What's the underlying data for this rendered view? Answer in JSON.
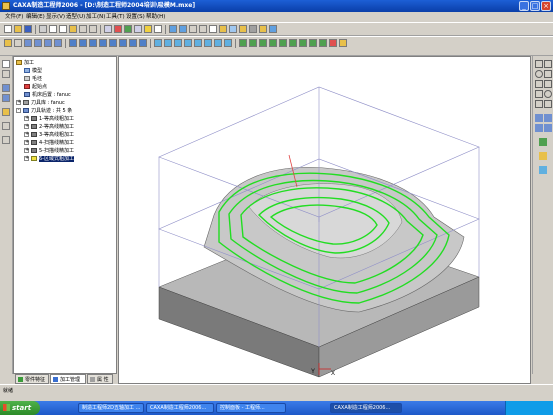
{
  "window": {
    "title": "CAXA制造工程师2006 - [D:\\制造工程师2004培训\\吸模M.mxe]"
  },
  "menu": [
    "文件(F)",
    "编辑(E)",
    "显示(V)",
    "造型(U)",
    "加工(N)",
    "工具(T)",
    "设置(S)",
    "帮助(H)"
  ],
  "tree": {
    "items": [
      {
        "label": "加工",
        "level": 0,
        "icon": "folder-icon",
        "expander": ""
      },
      {
        "label": "模型",
        "level": 1,
        "icon": "model-icon",
        "expander": ""
      },
      {
        "label": "毛坯",
        "level": 1,
        "icon": "stock-icon",
        "expander": ""
      },
      {
        "label": "起始点",
        "level": 1,
        "icon": "start-point-icon",
        "expander": ""
      },
      {
        "label": "机床后置 : fanuc",
        "level": 1,
        "icon": "machine-icon",
        "expander": ""
      },
      {
        "label": "刀具库 : fanuc",
        "level": 1,
        "icon": "tool-library-icon",
        "expander": "+"
      },
      {
        "label": "刀具轨迹 : 共 5 条",
        "level": 1,
        "icon": "toolpath-icon",
        "expander": "-"
      },
      {
        "label": "1-等高线粗加工",
        "level": 2,
        "icon": "path-folder-icon",
        "expander": "+"
      },
      {
        "label": "2-等高线精加工",
        "level": 2,
        "icon": "path-folder-icon",
        "expander": "+"
      },
      {
        "label": "3-等高线粗加工",
        "level": 2,
        "icon": "path-folder-icon",
        "expander": "+"
      },
      {
        "label": "4-扫描线精加工",
        "level": 2,
        "icon": "path-folder-icon",
        "expander": "+"
      },
      {
        "label": "5-扫描线精加工",
        "level": 2,
        "icon": "path-folder-icon",
        "expander": "+"
      },
      {
        "label": "6-区域式粗加工",
        "level": 2,
        "icon": "path-folder-icon",
        "expander": "+",
        "selected": true
      }
    ]
  },
  "panel_tabs": [
    "零件特征",
    "加工管理",
    "属 性"
  ],
  "status": {
    "text": "就绪"
  },
  "taskbar": {
    "start": "start",
    "buttons": [
      "制造工程师2D五轴加工 ...",
      "CAXA制造工程师2006...",
      "控制面板 - 工程师..."
    ],
    "active": "CAXA制造工程师2006..."
  },
  "viewport": {
    "axis_y": "Y",
    "axis_x": "X"
  },
  "colors": {
    "toolpath": "#22dd22",
    "selection": "#0a246a",
    "titlebar": "#1d5fd6"
  }
}
